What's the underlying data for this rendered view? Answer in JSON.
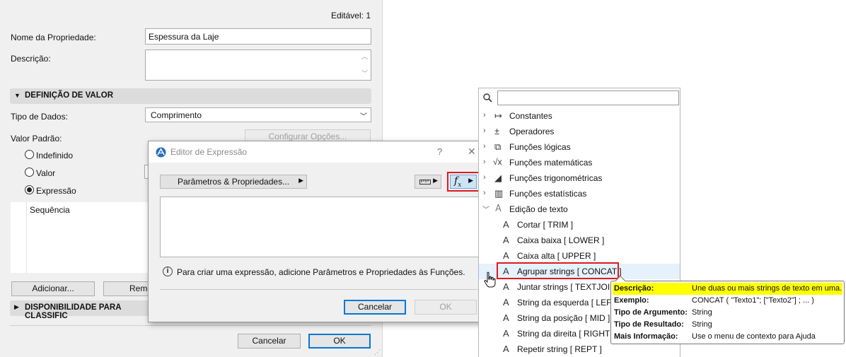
{
  "left_panel": {
    "editable_label": "Editável: 1",
    "property_name_label": "Nome da Propriedade:",
    "property_name_value": "Espessura da Laje",
    "description_label": "Descrição:",
    "description_value": "",
    "value_definition_header": "DEFINIÇÃO DE VALOR",
    "data_type_label": "Tipo de Dados:",
    "data_type_value": "Comprimento",
    "default_value_label": "Valor Padrão:",
    "configure_options_label": "Configurar Opções...",
    "radio_undefined": "Indefinido",
    "radio_value": "Valor",
    "radio_expression": "Expressão",
    "sequence_label": "Sequência",
    "add_button": "Adicionar...",
    "remove_button_partial": "Remo",
    "availability_header": "DISPONIBILIDADE PARA CLASSIFIC",
    "cancel_button": "Cancelar",
    "ok_button": "OK"
  },
  "dialog": {
    "title": "Editor de Expressão",
    "help_glyph": "?",
    "close_glyph": "✕",
    "params_button": "Parâmetros & Propriedades...",
    "info_text": "Para criar uma expressão, adicione Parâmetros e Propriedades às Funções.",
    "cancel_button": "Cancelar",
    "ok_button": "OK"
  },
  "function_tree": {
    "search_placeholder": "",
    "categories": [
      {
        "label": "Constantes",
        "icon": "constants-icon",
        "glyph": "↦"
      },
      {
        "label": "Operadores",
        "icon": "operators-icon",
        "glyph": "±"
      },
      {
        "label": "Funções lógicas",
        "icon": "logic-functions-icon",
        "glyph": "⧉"
      },
      {
        "label": "Funções matemáticas",
        "icon": "math-functions-icon",
        "glyph": "√x"
      },
      {
        "label": "Funções trigonométricas",
        "icon": "trig-functions-icon",
        "glyph": "◢"
      },
      {
        "label": "Funções estatísticas",
        "icon": "stats-functions-icon",
        "glyph": "▥"
      },
      {
        "label": "Edição de texto",
        "icon": "text-editing-icon",
        "glyph": "A"
      }
    ],
    "text_functions": [
      {
        "label": "Cortar [ TRIM ]"
      },
      {
        "label": "Caixa baixa [ LOWER ]"
      },
      {
        "label": "Caixa alta [ UPPER ]"
      },
      {
        "label": "Agrupar strings [ CONCAT ]"
      },
      {
        "label": "Juntar strings [ TEXTJOIN ]"
      },
      {
        "label": "String da esquerda [ LEFT ]"
      },
      {
        "label": "String da posição [ MID ]"
      },
      {
        "label": "String da direita [ RIGHT ]"
      },
      {
        "label": "Repetir string [ REPT ]"
      }
    ]
  },
  "tooltip": {
    "description_key": "Descrição:",
    "description_value": "Une duas ou mais strings de texto em uma.",
    "example_key": "Exemplo:",
    "example_value": "CONCAT ( \"Texto1\"; [\"Texto2\"] ; ... )",
    "argument_type_key": "Tipo de Argumento:",
    "argument_type_value": "String",
    "result_type_key": "Tipo de Resultado:",
    "result_type_value": "String",
    "more_info_key": "Mais Informação:",
    "more_info_value": "Use o menu de contexto para Ajuda"
  },
  "colors": {
    "highlight_red": "#e0191e",
    "tooltip_yellow": "#ffff00",
    "hover_blue": "#e5f1fb",
    "accent_blue": "#0078d7"
  }
}
